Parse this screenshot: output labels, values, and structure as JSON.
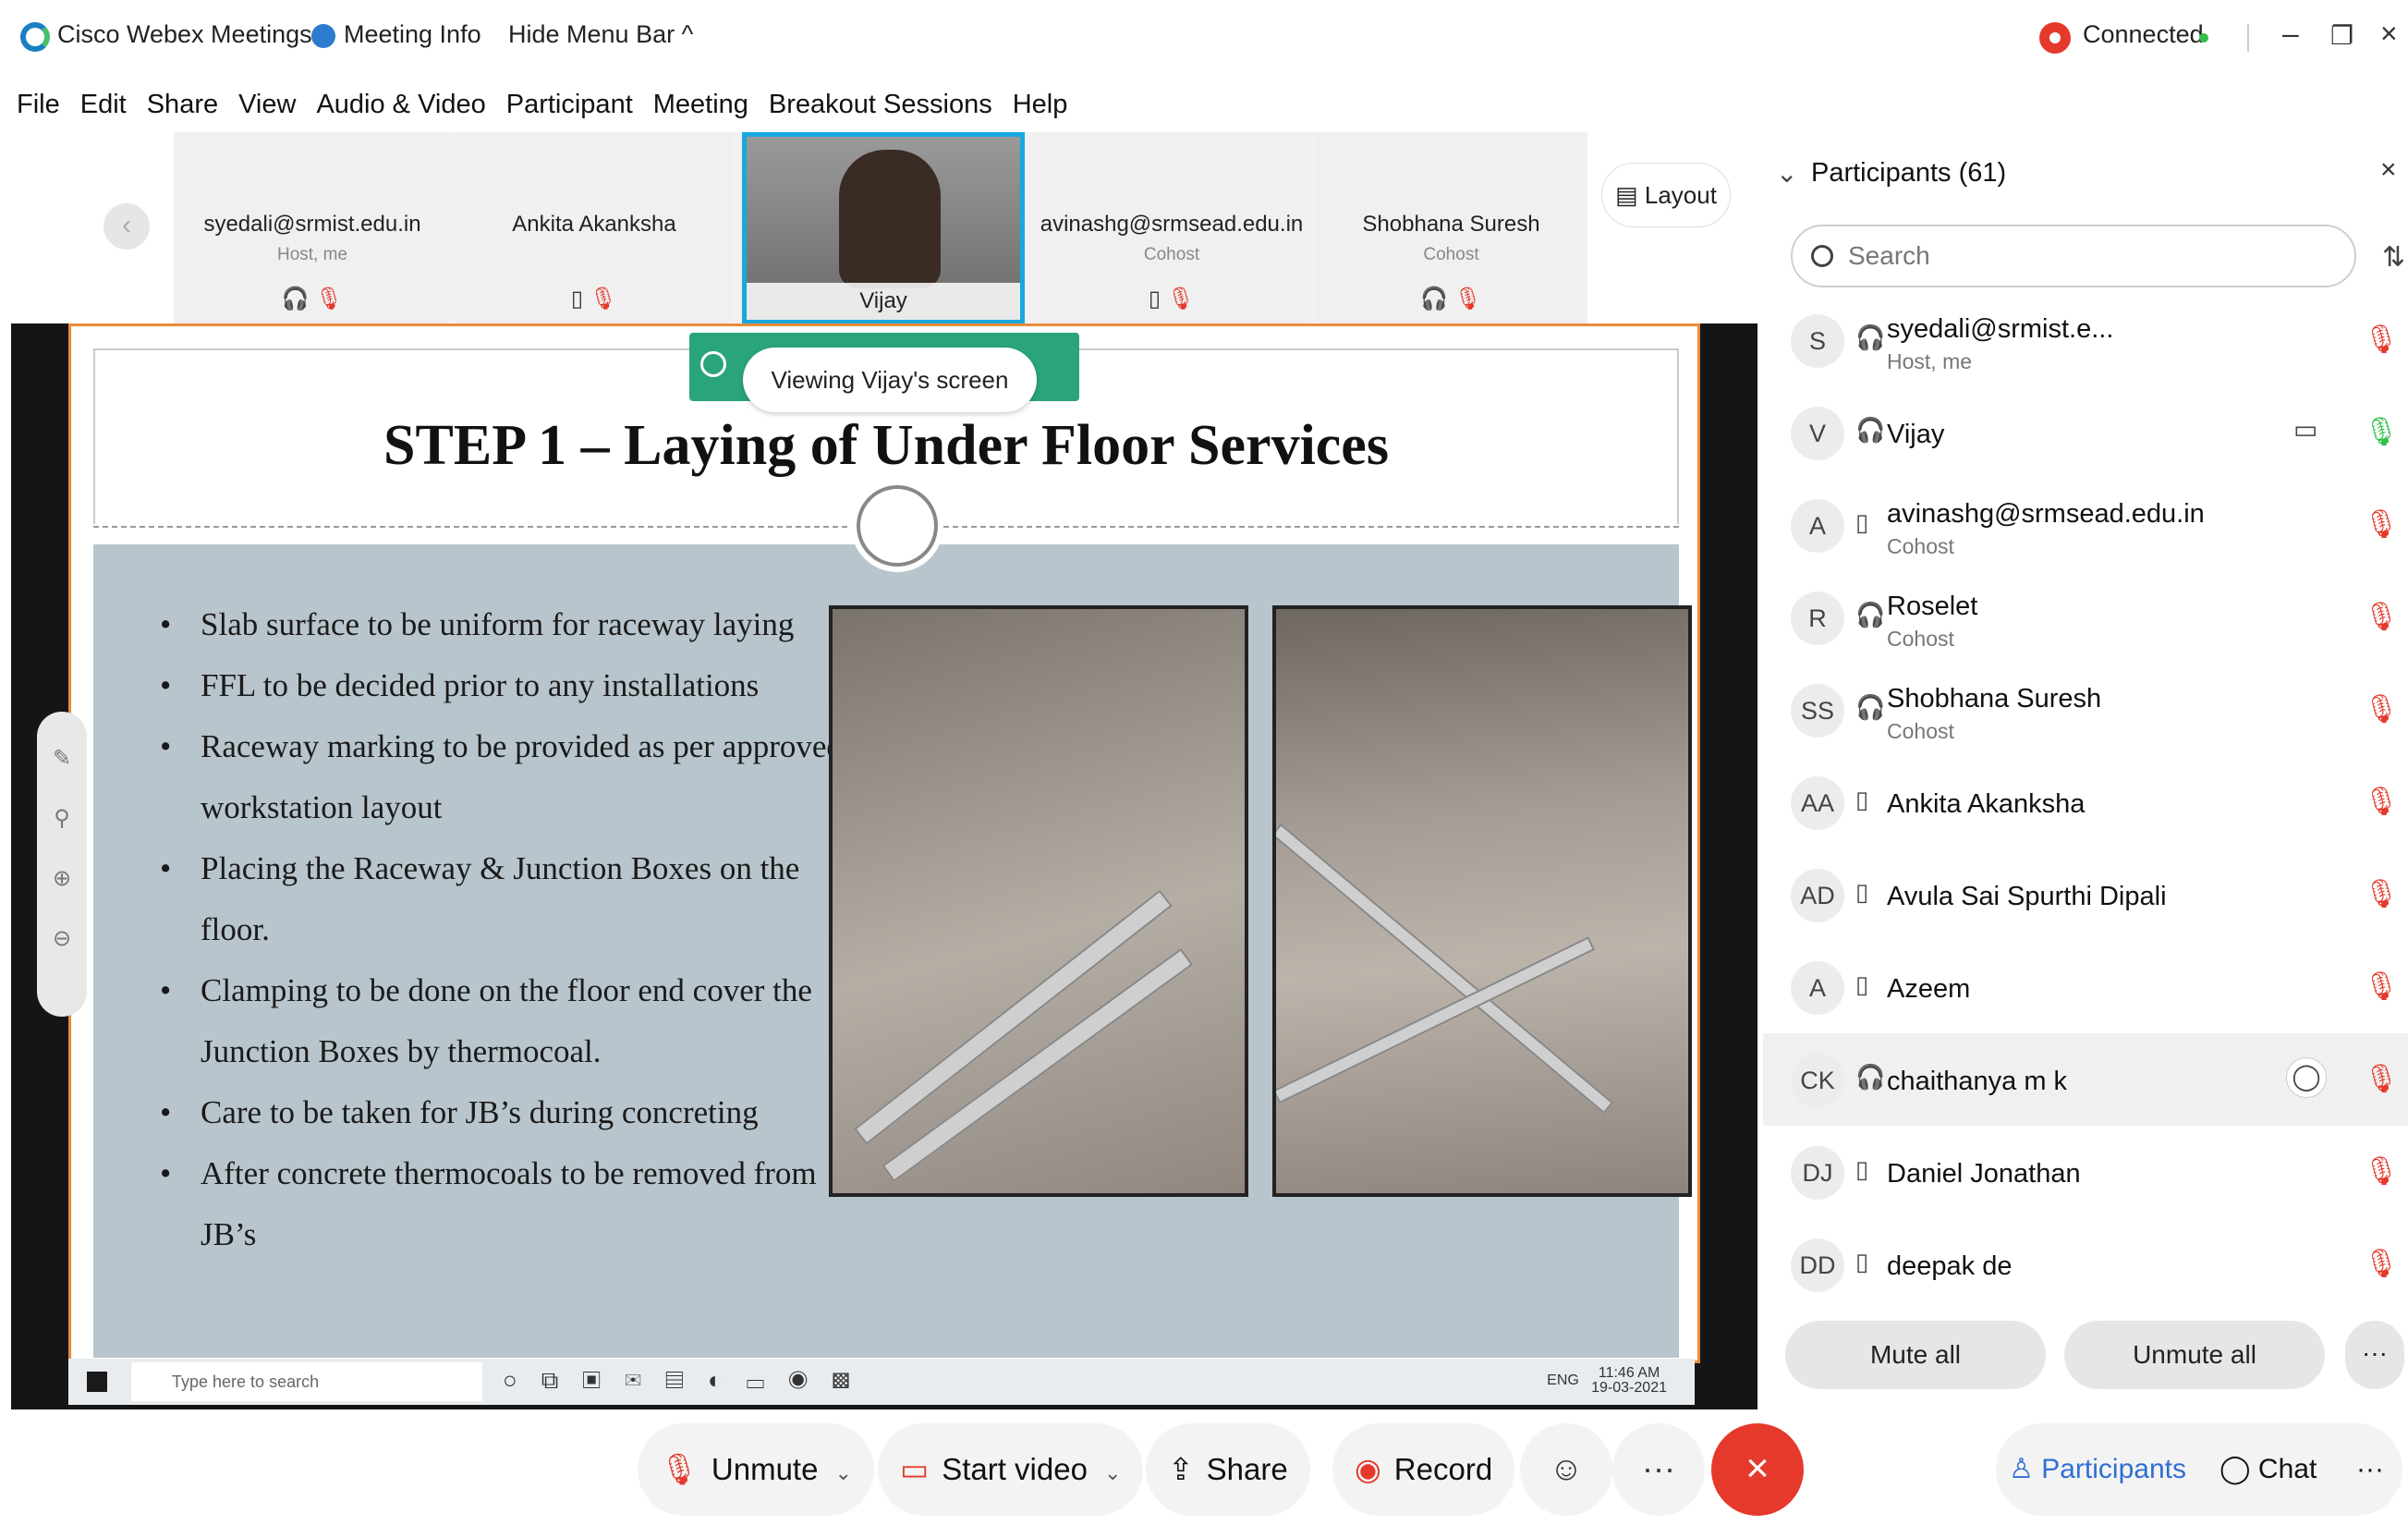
{
  "titlebar": {
    "app_name": "Cisco Webex Meetings",
    "meeting_info": "Meeting Info",
    "hide_menu": "Hide Menu Bar ^",
    "status": "Connected",
    "minimize": "–",
    "restore": "❐",
    "close": "×"
  },
  "menu": [
    "File",
    "Edit",
    "Share",
    "View",
    "Audio & Video",
    "Participant",
    "Meeting",
    "Breakout Sessions",
    "Help"
  ],
  "filmstrip": {
    "prev": "‹",
    "tiles": [
      {
        "name": "syedali@srmist.edu.in",
        "role": "Host, me"
      },
      {
        "name": "Ankita Akanksha",
        "role": ""
      },
      {
        "name": "Vijay",
        "role": ""
      },
      {
        "name": "avinashg@srmsead.edu.in",
        "role": "Cohost"
      },
      {
        "name": "Shobhana Suresh",
        "role": "Cohost"
      }
    ],
    "layout_label": "Layout"
  },
  "share": {
    "viewing_label": "Viewing Vijay's screen",
    "slide_title": "STEP 1 – Laying of Under Floor Services",
    "bullets": [
      "Slab surface to be uniform for raceway laying",
      "FFL to be decided prior to any installations",
      "Raceway marking to be provided as per approved workstation layout",
      "Placing the Raceway & Junction Boxes on the floor.",
      "Clamping to be done on the floor end cover the Junction Boxes by thermocoal.",
      "Care to be taken for JB’s during concreting",
      "After concrete thermocoals to be removed from JB’s"
    ],
    "taskbar_search": "Type here to search",
    "clock_time": "11:46 AM",
    "clock_date": "19-03-2021",
    "lang": "ENG"
  },
  "participants": {
    "title": "Participants (61)",
    "search_placeholder": "Search",
    "list": [
      {
        "initials": "S",
        "name": "syedali@srmist.e...",
        "role": "Host, me"
      },
      {
        "initials": "V",
        "name": "Vijay",
        "role": ""
      },
      {
        "initials": "A",
        "name": "avinashg@srmsead.edu.in",
        "role": "Cohost"
      },
      {
        "initials": "R",
        "name": "Roselet",
        "role": "Cohost"
      },
      {
        "initials": "SS",
        "name": "Shobhana Suresh",
        "role": "Cohost"
      },
      {
        "initials": "AA",
        "name": "Ankita Akanksha",
        "role": ""
      },
      {
        "initials": "AD",
        "name": "Avula Sai Spurthi Dipali",
        "role": ""
      },
      {
        "initials": "A",
        "name": "Azeem",
        "role": ""
      },
      {
        "initials": "CK",
        "name": "chaithanya m k",
        "role": ""
      },
      {
        "initials": "DJ",
        "name": "Daniel Jonathan",
        "role": ""
      },
      {
        "initials": "DD",
        "name": "deepak de",
        "role": ""
      }
    ],
    "mute_all": "Mute all",
    "unmute_all": "Unmute all",
    "more": "···"
  },
  "controls": {
    "unmute": "Unmute",
    "start_video": "Start video",
    "share": "Share",
    "record": "Record",
    "more": "···",
    "participants": "Participants",
    "chat": "Chat"
  },
  "colors": {
    "accent_blue": "#2f6fd3",
    "active_tile_border": "#19a8e0",
    "end_red": "#e5392b",
    "viewing_green": "#2aa57a",
    "slide_body": "#b8c5cc"
  }
}
